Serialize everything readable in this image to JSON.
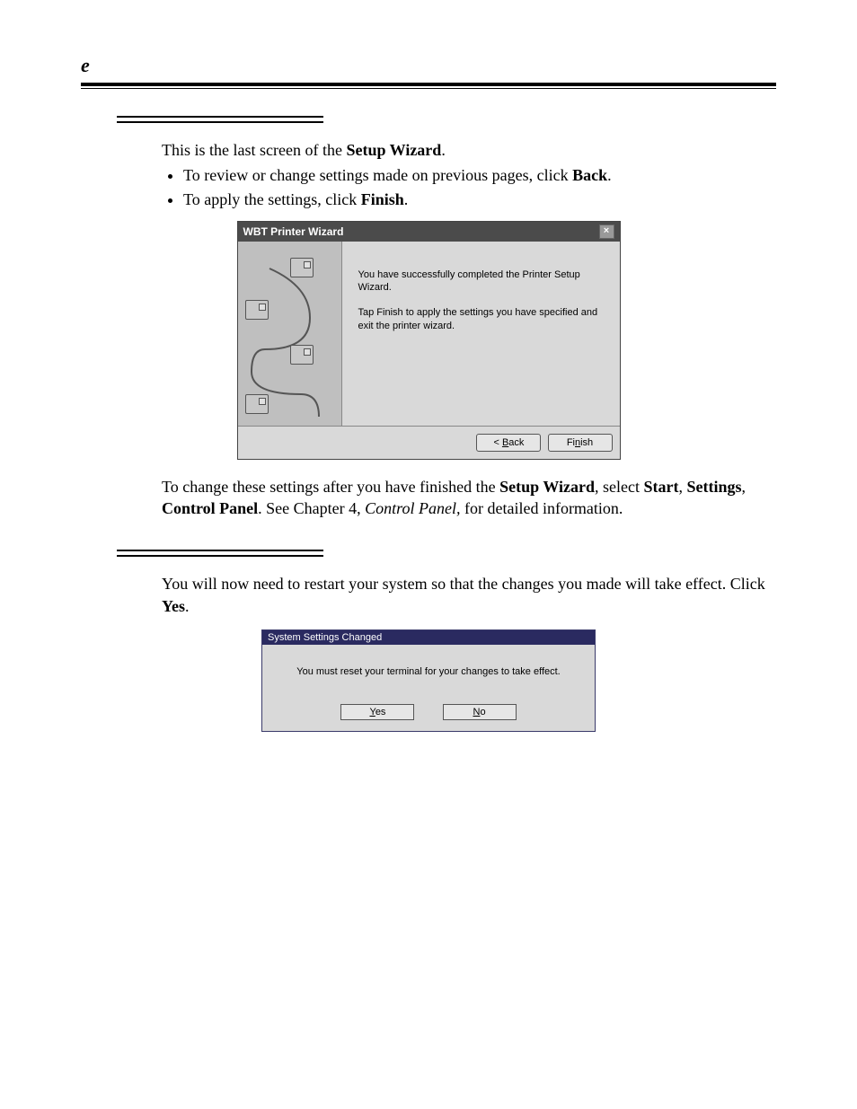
{
  "page": {
    "header_letter": "e"
  },
  "intro": {
    "line1_pre": "This is the last screen of the ",
    "line1_bold": "Setup Wizard",
    "line1_post": ".",
    "bullet1_pre": "To review or change settings made on previous pages, click ",
    "bullet1_bold": "Back",
    "bullet1_post": ".",
    "bullet2_pre": "To apply the settings, click ",
    "bullet2_bold": "Finish",
    "bullet2_post": "."
  },
  "wizard": {
    "title": "WBT Printer Wizard",
    "close_glyph": "×",
    "msg1": "You have successfully completed the Printer Setup Wizard.",
    "msg2": "Tap Finish to apply the settings you have specified and exit the printer wizard.",
    "back_label": "< Back",
    "finish_label": "Finish",
    "back_access": "B",
    "finish_access": "n"
  },
  "post_wizard": {
    "p1_pre": "To change these settings after you have finished the ",
    "p1_b1": "Setup Wizard",
    "p1_mid1": ", select ",
    "p1_b2": "Start",
    "p1_mid2": ", ",
    "p1_b3": "Settings",
    "p1_mid3": ", ",
    "p1_b4": "Control Panel",
    "p1_mid4": ". See Chapter 4, ",
    "p1_italic": "Control Panel,",
    "p1_post": " for detailed information."
  },
  "restart": {
    "p_pre": "You will now need to restart your system so that the changes you made will take effect. Click ",
    "p_bold": "Yes",
    "p_post": "."
  },
  "dialog": {
    "title": "System Settings Changed",
    "message": "You must reset your terminal for your changes to take effect.",
    "yes_u": "Y",
    "yes_rest": "es",
    "no_u": "N",
    "no_rest": "o"
  }
}
